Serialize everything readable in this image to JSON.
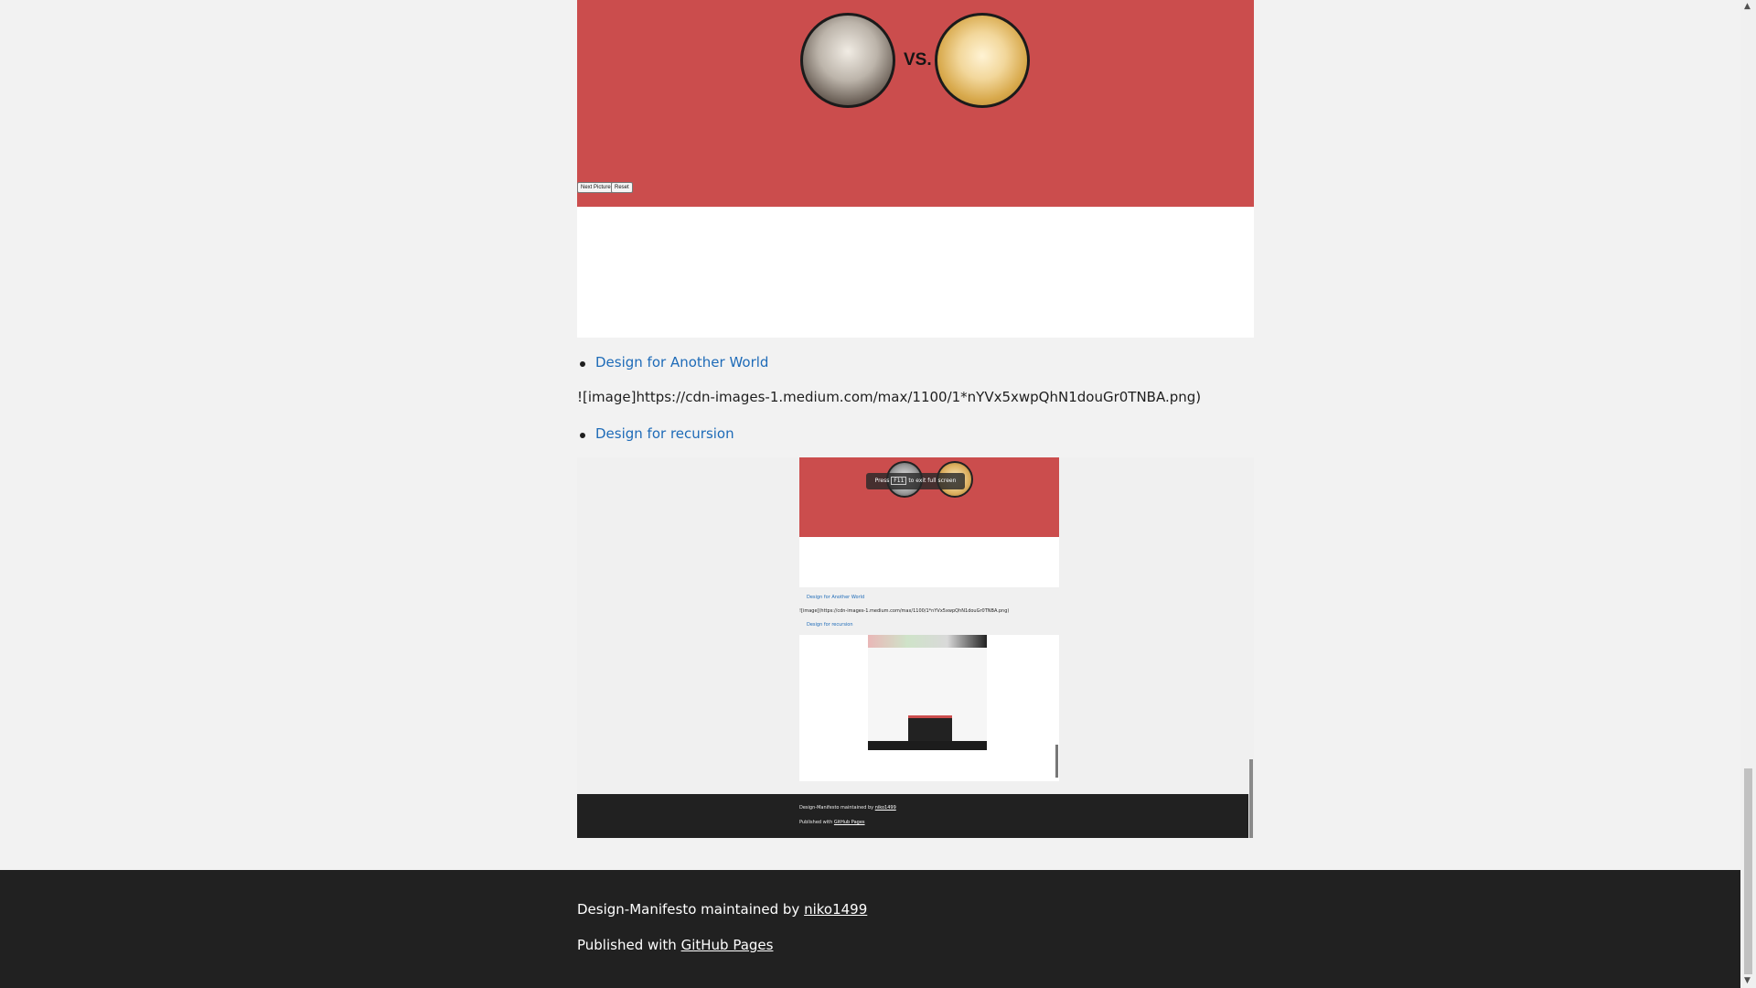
{
  "hero": {
    "vs_text": "VS.",
    "buttons": [
      "Next Picture",
      "Reset"
    ]
  },
  "links": {
    "another_world": "Design for Another World",
    "image_markdown": "![image]https://cdn-images-1.medium.com/max/1100/1*nYVx5xwpQhN1douGr0TNBA.png)",
    "recursion": "Design for recursion"
  },
  "embedded": {
    "toast_prefix": "Press",
    "toast_key": "F11",
    "toast_suffix": "to exit full screen",
    "link_another_world": "Design for Another World",
    "image_markdown": "![image](https://cdn-images-1.medium.com/max/1100/1*nYVx5xwpQhN1douGr0TNBA.png)",
    "link_recursion": "Design for recursion",
    "footer_maintained": "Design-Manifesto maintained by",
    "footer_user": "niko1499",
    "footer_published": "Published with",
    "footer_pages": "GitHub Pages"
  },
  "footer": {
    "maintained_prefix": "Design-Manifesto maintained by",
    "maintainer": "niko1499",
    "published_prefix": "Published with",
    "published_link": "GitHub Pages"
  },
  "icons": {
    "scroll_up": "up-arrow",
    "scroll_down": "down-arrow"
  }
}
